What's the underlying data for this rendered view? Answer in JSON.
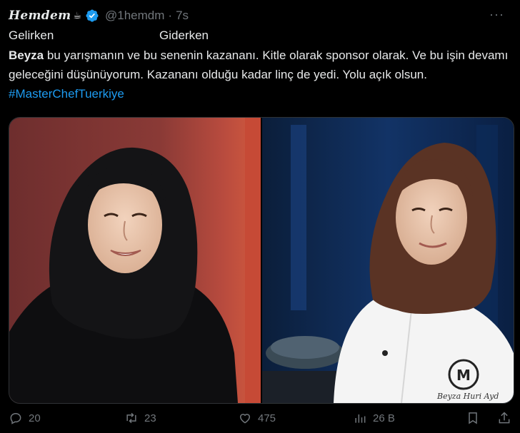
{
  "tweet": {
    "display_name": "Hemdem",
    "name_glyph": "☕",
    "handle": "@1hemdm",
    "separator": "·",
    "time": "7s",
    "more_label": "···",
    "label_left": "Gelirken",
    "label_right": "Giderken",
    "text_bold": "Beyza",
    "text_main": " bu yarışmanın ve bu senenin kazananı. Kitle olarak sponsor olarak. Ve bu işin devamı geleceğini düşünüyorum. Kazananı olduğu kadar linç de yedi. Yolu açık olsun. ",
    "hashtag": "#MasterChefTuerkiye"
  },
  "media": {
    "left_alt": "Gelirken",
    "right_alt": "Giderken",
    "chef_name_embroidery": "Beyza Huri Ayd",
    "chef_logo_letter": "M"
  },
  "actions": {
    "replies": "20",
    "reposts": "23",
    "likes": "475",
    "views": "26 B"
  },
  "colors": {
    "background": "#000000",
    "text": "#e7e9ea",
    "muted": "#71767b",
    "accent": "#1d9bf0"
  }
}
